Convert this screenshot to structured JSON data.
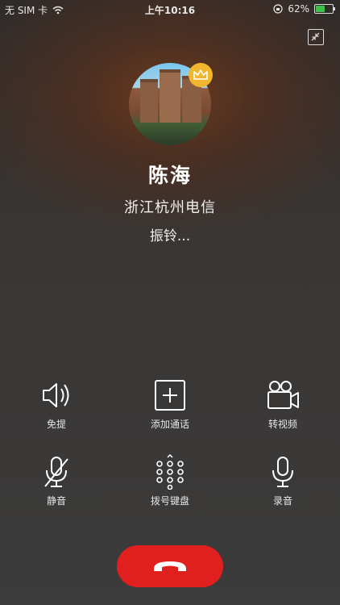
{
  "status_bar": {
    "carrier": "无 SIM 卡",
    "time": "上午10:16",
    "battery": "62%",
    "battery_level": 0.62
  },
  "caller": {
    "name": "陈海",
    "location": "浙江杭州电信",
    "status": "振铃..."
  },
  "controls": [
    {
      "label": "免提",
      "icon": "speaker-icon"
    },
    {
      "label": "添加通话",
      "icon": "add-call-icon"
    },
    {
      "label": "转视频",
      "icon": "video-camera-icon"
    },
    {
      "label": "静音",
      "icon": "mic-off-icon"
    },
    {
      "label": "拨号键盘",
      "icon": "dialpad-icon"
    },
    {
      "label": "录音",
      "icon": "microphone-icon"
    }
  ],
  "colors": {
    "end_call": "#e01f1f",
    "battery": "#3ec24d",
    "crown": "#f2b52e"
  }
}
